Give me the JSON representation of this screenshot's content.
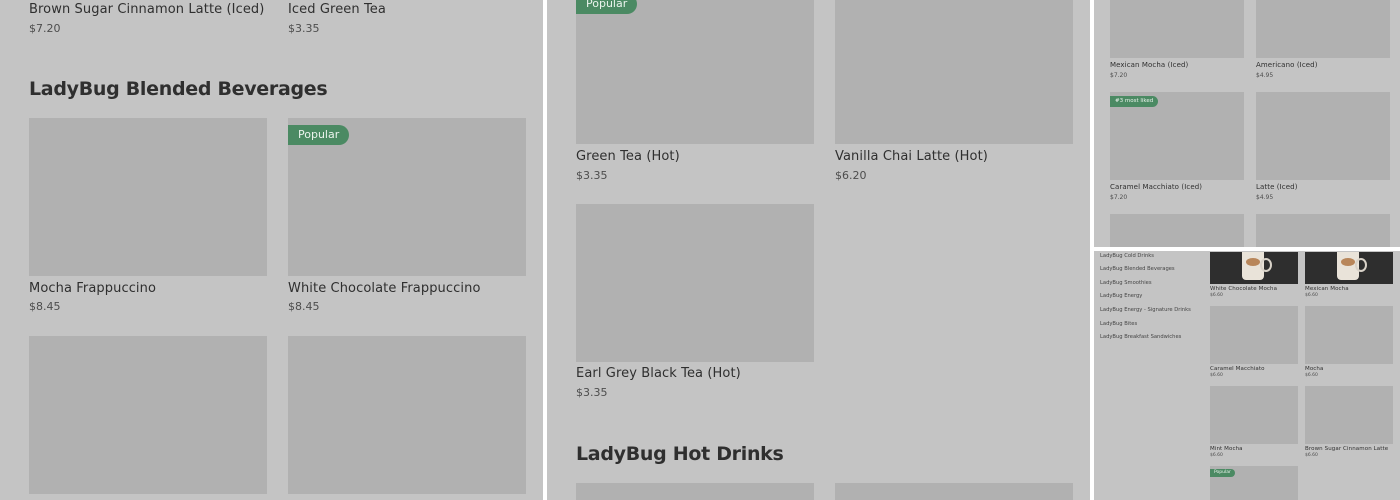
{
  "panel_a": {
    "top_items": [
      {
        "name": "Brown Sugar Cinnamon Latte (Iced)",
        "price": "$7.20"
      },
      {
        "name": "Iced Green Tea",
        "price": "$3.35"
      }
    ],
    "section_title": "LadyBug Blended Beverages",
    "items": [
      {
        "name": "Mocha Frappuccino",
        "price": "$8.45",
        "badge": ""
      },
      {
        "name": "White Chocolate Frappuccino",
        "price": "$8.45",
        "badge": "Popular"
      }
    ]
  },
  "panel_b": {
    "top_badge": "Popular",
    "items": [
      {
        "name": "Green Tea (Hot)",
        "price": "$3.35"
      },
      {
        "name": "Vanilla Chai Latte (Hot)",
        "price": "$6.20"
      },
      {
        "name": "Earl Grey Black Tea (Hot)",
        "price": "$3.35"
      }
    ],
    "section_title": "LadyBug Hot Drinks"
  },
  "panel_c": {
    "items": [
      {
        "name": "Mexican Mocha (Iced)",
        "price": "$7.20"
      },
      {
        "name": "Americano (Iced)",
        "price": "$4.95"
      },
      {
        "name": "Caramel Macchiato (Iced)",
        "price": "$7.20",
        "badge": "#3 most liked"
      },
      {
        "name": "Latte (Iced)",
        "price": "$4.95"
      }
    ]
  },
  "panel_d": {
    "categories": [
      "LadyBug Cold Drinks",
      "LadyBug Blended Beverages",
      "LadyBug Smoothies",
      "LadyBug Energy",
      "LadyBug Energy - Signature Drinks",
      "LadyBug Bites",
      "LadyBug Breakfast Sandwiches"
    ],
    "items": [
      {
        "name": "White Chocolate Mocha",
        "price": "$6.60"
      },
      {
        "name": "Mexican Mocha",
        "price": "$6.60"
      },
      {
        "name": "Caramel Macchiato",
        "price": "$6.60"
      },
      {
        "name": "Mocha",
        "price": "$6.60"
      },
      {
        "name": "Mint Mocha",
        "price": "$6.60"
      },
      {
        "name": "Brown Sugar Cinnamon Latte",
        "price": "$6.60"
      }
    ],
    "bottom_badge": "Popular"
  },
  "colors": {
    "overlay": "#c4c4c4",
    "image_placeholder": "#b1b1b1",
    "badge_green": "#4b8a63",
    "photo_dark": "#2e2e2e"
  },
  "icons": {
    "drink_photo": "coffee-cup-photo"
  }
}
